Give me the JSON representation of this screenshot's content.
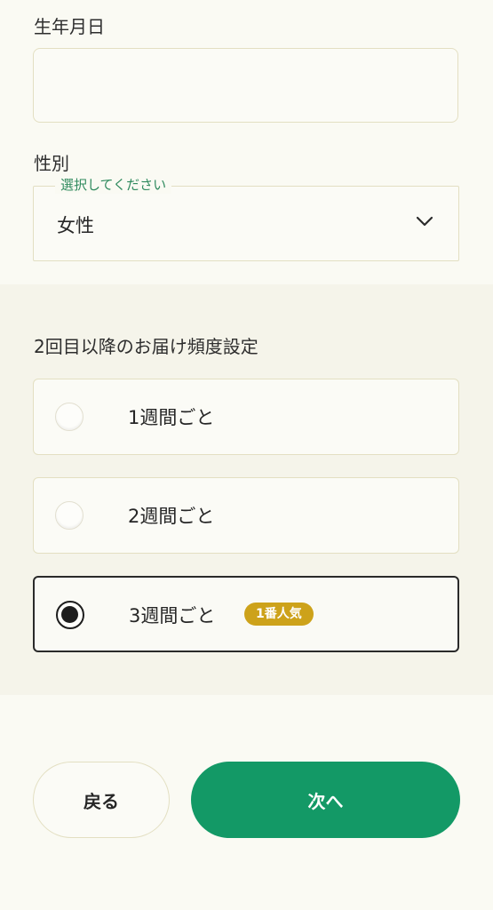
{
  "birthdate": {
    "label": "生年月日",
    "value": ""
  },
  "gender": {
    "label": "性別",
    "legend": "選択してください",
    "value": "女性"
  },
  "frequency": {
    "title": "2回目以降のお届け頻度設定",
    "options": [
      {
        "label": "1週間ごと",
        "selected": false,
        "badge": ""
      },
      {
        "label": "2週間ごと",
        "selected": false,
        "badge": ""
      },
      {
        "label": "3週間ごと",
        "selected": true,
        "badge": "1番人気"
      }
    ]
  },
  "buttons": {
    "back_label": "戻る",
    "next_label": "次へ"
  },
  "colors": {
    "primary": "#139966",
    "badge": "#cda21a",
    "legend": "#2f8a5e",
    "border": "#e3dfc2"
  }
}
